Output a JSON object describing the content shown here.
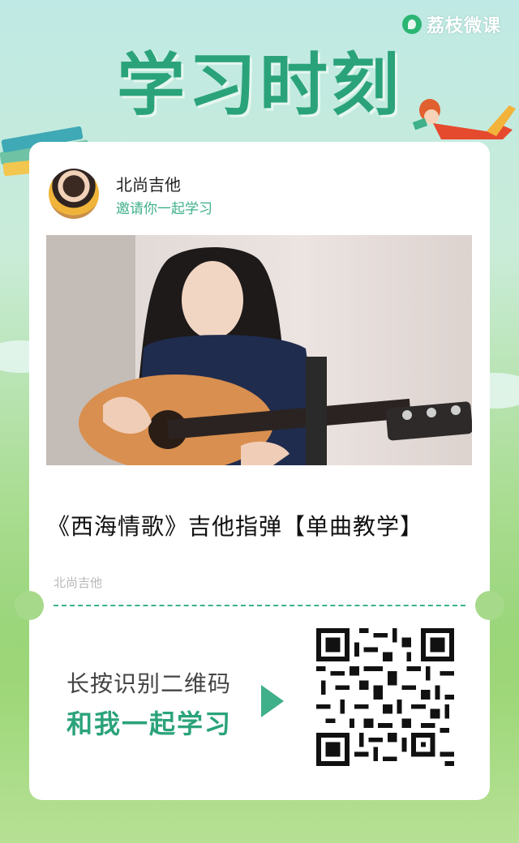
{
  "brand": {
    "name": "荔枝微课",
    "icon": "lychee-logo-icon"
  },
  "header": {
    "title": "学习时刻"
  },
  "author": {
    "name": "北尚吉他",
    "invite": "邀请你一起学习",
    "avatar": "guitarist-avatar"
  },
  "course": {
    "title": "《西海情歌》吉他指弹【单曲教学】",
    "author": "北尚吉他",
    "cover": "woman-playing-acoustic-guitar"
  },
  "scan": {
    "line1": "长按识别二维码",
    "line2": "和我一起学习",
    "arrow_icon": "play-arrow-icon",
    "qr": "qr-code"
  },
  "colors": {
    "accent": "#2ba37a",
    "accent_light": "#3fb08a",
    "background_top": "#bfe9e4",
    "background_bottom": "#8fd06c"
  }
}
